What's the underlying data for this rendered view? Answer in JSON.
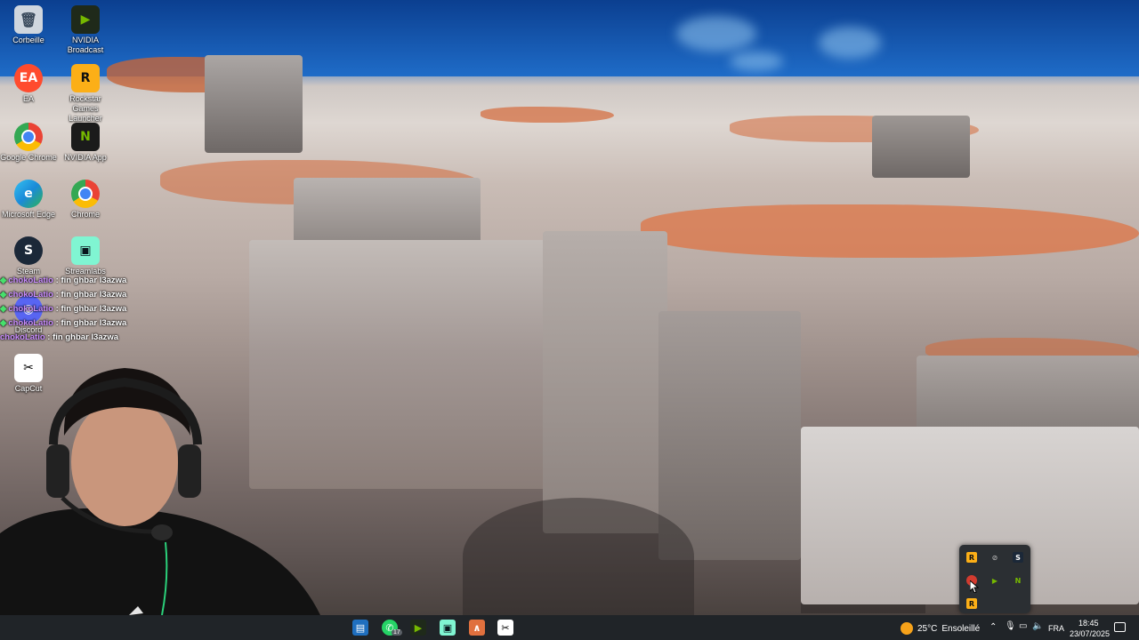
{
  "desktop_icons": [
    {
      "label": "Corbeille",
      "icon": "recycle-bin-icon",
      "color": "#cfd6de"
    },
    {
      "label": "NVIDIA Broadcast",
      "icon": "nvidia-broadcast-icon",
      "color": "#1f2a1a"
    },
    {
      "label": "EA",
      "icon": "ea-app-icon",
      "color": "#ff4b2e"
    },
    {
      "label": "Rockstar Games Launcher",
      "icon": "rockstar-games-icon",
      "color": "#fcaf17"
    },
    {
      "label": "Google Chrome",
      "icon": "chrome-icon",
      "color": "#ffffff"
    },
    {
      "label": "NVIDIA App",
      "icon": "nvidia-app-icon",
      "color": "#76b900"
    },
    {
      "label": "Microsoft Edge",
      "icon": "edge-icon",
      "color": "#1a8ad8"
    },
    {
      "label": "Chrome",
      "icon": "chrome-icon",
      "color": "#ffffff"
    },
    {
      "label": "Steam",
      "icon": "steam-icon",
      "color": "#1b2838"
    },
    {
      "label": "Streamlabs",
      "icon": "streamlabs-icon",
      "color": "#80f5d2"
    },
    {
      "label": "Discord",
      "icon": "discord-icon",
      "color": "#5865f2"
    },
    {
      "label": "CapCut",
      "icon": "capcut-icon",
      "color": "#ffffff"
    }
  ],
  "chat": {
    "messages": [
      {
        "user": "chokoLatio",
        "sep": " : ",
        "text": "fin ghbar l3azwa"
      },
      {
        "user": "chokoLatio",
        "sep": " : ",
        "text": "fin ghbar l3azwa"
      },
      {
        "user": "chokoLatio",
        "sep": " : ",
        "text": "fin ghbar l3azwa"
      },
      {
        "user": "chokoLatio",
        "sep": " : ",
        "text": "fin ghbar l3azwa"
      },
      {
        "user": "chokoLatio",
        "sep": " : ",
        "text": "fin ghbar l3azwa"
      }
    ]
  },
  "taskbar": {
    "apps": [
      "file-explorer-icon",
      "whatsapp-icon",
      "nvidia-broadcast-icon",
      "streamlabs-icon",
      "accent-app-icon",
      "capcut-icon"
    ],
    "whatsapp_badge": "17",
    "weather": {
      "temp": "25°C",
      "condition": "Ensoleillé",
      "icon": "sun-icon"
    },
    "language": "FRA",
    "time": "18:45",
    "date": "23/07/2025"
  },
  "tray_popup": {
    "icons": [
      "rockstar-tray-icon",
      "network-off-icon",
      "steam-tray-icon",
      "obs-record-icon",
      "nvidia-broadcast-tray-icon",
      "nvidia-tray-icon",
      "rockstar-launcher-tray-icon"
    ]
  },
  "colors": {
    "taskbar": "#202428",
    "accent_orange": "#d4693a",
    "sky": "#1b64c0"
  }
}
